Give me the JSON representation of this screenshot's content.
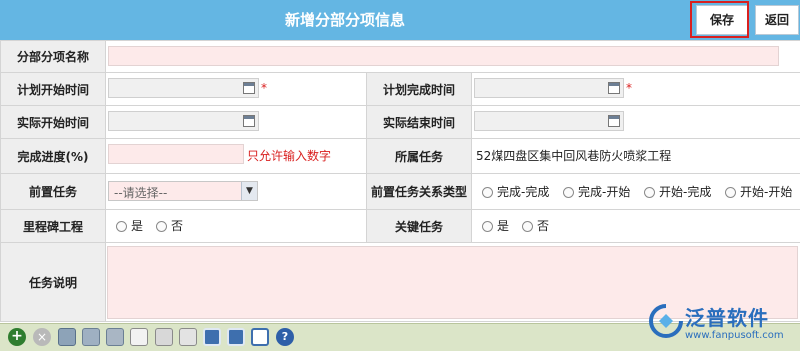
{
  "header": {
    "title": "新增分部分项信息",
    "save_label": "保存",
    "back_label": "返回"
  },
  "form": {
    "section_name_label": "分部分项名称",
    "plan_start_label": "计划开始时间",
    "plan_end_label": "计划完成时间",
    "actual_start_label": "实际开始时间",
    "actual_end_label": "实际结束时间",
    "progress_label": "完成进度(%)",
    "progress_hint": "只允许输入数字",
    "task_label": "所属任务",
    "task_value": "52煤四盘区集中回风巷防火喷浆工程",
    "predecessor_label": "前置任务",
    "predecessor_placeholder": "--请选择--",
    "relation_type_label": "前置任务关系类型",
    "relation_options": [
      "完成-完成",
      "完成-开始",
      "开始-完成",
      "开始-开始"
    ],
    "milestone_label": "里程碑工程",
    "key_task_label": "关键任务",
    "yes_label": "是",
    "no_label": "否",
    "description_label": "任务说明",
    "required_mark": "*"
  },
  "logo": {
    "name": "泛普软件",
    "url": "www.fanpusoft.com"
  },
  "colors": {
    "header_bg": "#64b6e3",
    "label_bg": "#eeeeee",
    "input_required_bg": "#fdeaea",
    "highlight_border": "#d9201f",
    "toolbar_bg": "#dbe5c8",
    "logo_blue": "#2a6ebd"
  },
  "toolbar_icons": [
    "add-icon",
    "delete-icon",
    "print-preview-icon",
    "save-disk-icon",
    "save-as-icon",
    "document-icon",
    "folder-icon",
    "print-icon",
    "grid-icon",
    "calendar-grid-icon",
    "list-icon",
    "help-icon"
  ]
}
